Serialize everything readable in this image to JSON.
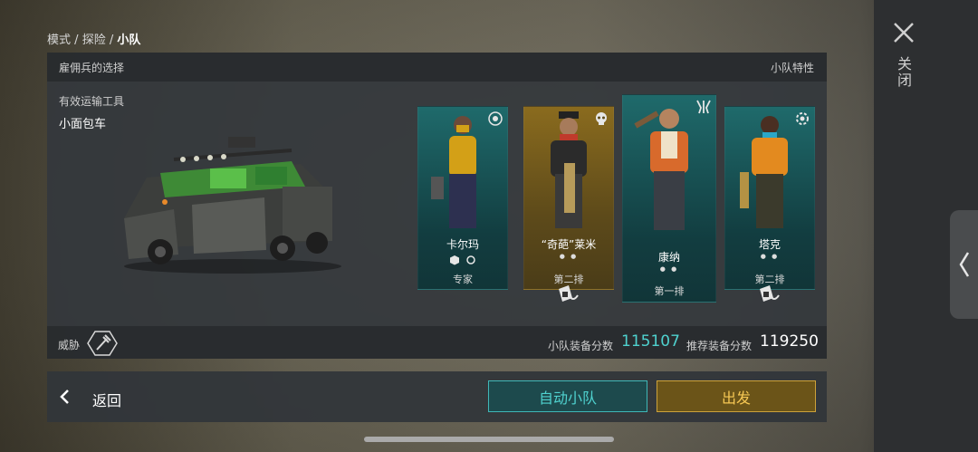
{
  "breadcrumb": {
    "part1": "模式",
    "part2": "探险",
    "current": "小队",
    "sep": "/"
  },
  "close": {
    "label": "关闭"
  },
  "panel": {
    "title": "雇佣兵的选择",
    "traits_label": "小队特性",
    "vehicle_label": "有效运输工具",
    "vehicle_name": "小面包车",
    "threat_label": "威胁",
    "squad_score_label": "小队装备分数",
    "squad_score": "115107",
    "rec_score_label": "推荐装备分数",
    "rec_score": "119250"
  },
  "mercenaries": [
    {
      "name": "卡尔玛",
      "role": "专家",
      "icon": "eye-gear-icon"
    },
    {
      "name": "“奇葩”莱米",
      "role": "第二排",
      "icon": "skull-icon"
    },
    {
      "name": "康纳",
      "role": "第一排",
      "icon": "claw-icon"
    },
    {
      "name": "塔克",
      "role": "第二排",
      "icon": "gear-icon"
    }
  ],
  "bottom": {
    "back_label": "返回",
    "auto_label": "自动小队",
    "go_label": "出发"
  },
  "colors": {
    "teal": "#3fb7b7",
    "gold": "#cda23a",
    "panel": "#34383c"
  }
}
